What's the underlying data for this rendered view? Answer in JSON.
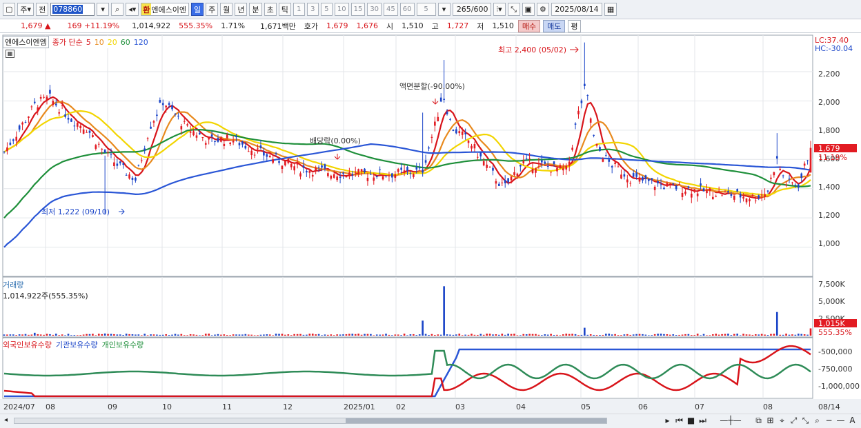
{
  "toolbar": {
    "period_main": "주",
    "prev_label": "전",
    "code": "078860",
    "hwan": "환",
    "stock_name": "엔에스이엔",
    "period_tabs": [
      "일",
      "주",
      "월",
      "년",
      "분",
      "초",
      "틱"
    ],
    "active_tab": "일",
    "interval_nums": [
      "1",
      "3",
      "5",
      "10",
      "15",
      "30",
      "45",
      "60"
    ],
    "interval_value": "5",
    "count_value": "265",
    "count_total": "/600",
    "date_value": "2025/08/14"
  },
  "quote": {
    "price": "1,679",
    "change_arrow": "▲",
    "change": "169",
    "change_pct": "+11.19%",
    "volume": "1,014,922",
    "volume_ratio": "555.35%",
    "turnover": "1.71%",
    "amount": "1,671백만",
    "hoga_label": "호가",
    "ask": "1,679",
    "bid": "1,676",
    "open_label": "시",
    "open": "1,510",
    "high_label": "고",
    "high": "1,727",
    "low_label": "저",
    "low": "1,510",
    "buy_label": "매수",
    "sell_label": "매도",
    "avg_label": "평"
  },
  "legend": {
    "name": "엔에스이엔엠",
    "indicator": "종가 단순",
    "ma_periods": [
      "5",
      "10",
      "20",
      "60",
      "120"
    ],
    "ma_colors": [
      "#d8141a",
      "#e88a1e",
      "#f2d500",
      "#1e8f3a",
      "#2a56d6"
    ]
  },
  "price_axis": {
    "labels": [
      "2,200",
      "2,000",
      "1,800",
      "1,600",
      "1,400",
      "1,200",
      "1,000"
    ],
    "lc": "LC:37.40",
    "hc": "HC:-30.04",
    "current": "1,679",
    "current_pct": "11.19%"
  },
  "annotations": {
    "high": "최고 2,400 (05/02)",
    "low": "최저 1,222 (09/10)",
    "dividend": "배당락(0.00%)",
    "split": "액면분할(-90.00%)"
  },
  "volume_panel": {
    "title": "거래량",
    "value": "1,014,922주(555.35%)",
    "axis_labels": [
      "7,500K",
      "5,000K",
      "2,500K"
    ],
    "current": "1,015K",
    "current_pct": "555.35%"
  },
  "holdings_panel": {
    "series": [
      "외국인보유수량",
      "기관보유수량",
      "개인보유수량"
    ],
    "axis_labels": [
      "-500,000",
      "-750,000",
      "-1,000,000"
    ]
  },
  "x_axis": {
    "labels": [
      "2024/07",
      "08",
      "09",
      "10",
      "11",
      "12",
      "2025/01",
      "02",
      "03",
      "04",
      "05",
      "06",
      "07",
      "08",
      "08/14"
    ]
  },
  "chart_data": {
    "type": "candlestick",
    "ylim": [
      800,
      2450
    ],
    "ma_periods": [
      5,
      10,
      20,
      60,
      120
    ],
    "events": [
      {
        "label": "최고 2,400 (05/02)",
        "value": 2400
      },
      {
        "label": "최저 1,222 (09/10)",
        "value": 1222
      },
      {
        "label": "배당락(0.00%)"
      },
      {
        "label": "액면분할(-90.00%)"
      }
    ],
    "last": {
      "open": 1510,
      "high": 1727,
      "low": 1510,
      "close": 1679,
      "volume": 1014922
    }
  }
}
